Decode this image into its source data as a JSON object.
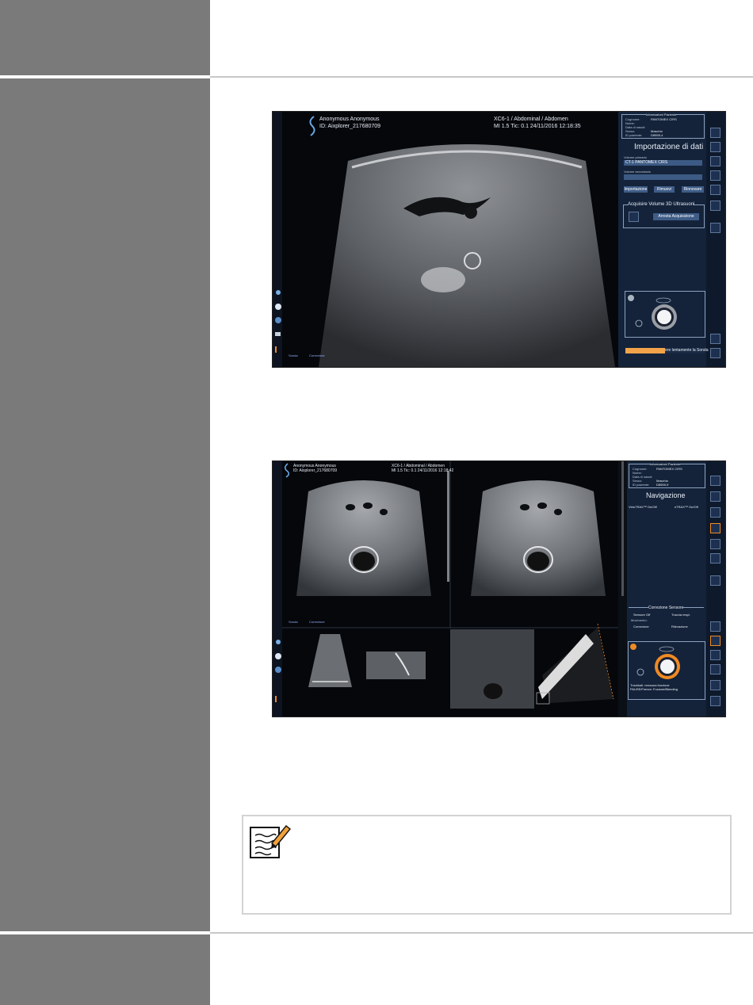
{
  "colors": {
    "sidebar": "#7a7a7a",
    "rule": "#c8c8c8",
    "panel": "#14233a",
    "accent_orange": "#f08a24",
    "field_blue": "#3c5a84"
  },
  "screen1": {
    "patient_name": "Anonymous Anonymous",
    "patient_id": "ID: Aixplorer_217680709",
    "probe_preset": "XC6-1 / Abdominal / Abdomen",
    "mi_tic_date": "MI 1.5  Tic: 0.1   24/11/2016 12:18:35",
    "patient_info": {
      "title": "Informazioni Paziente",
      "rows": [
        {
          "label": "Cognome:",
          "value": "PANTOMEX CIRS"
        },
        {
          "label": "Nome:",
          "value": ""
        },
        {
          "label": "Data di nascit:",
          "value": ""
        },
        {
          "label": "Sesso:",
          "value": "Maschio"
        },
        {
          "label": "ID paziente:",
          "value": "D8555-4"
        }
      ]
    },
    "section_title": "Importazione di dati",
    "primary_label": "Volume primario",
    "primary_value": "CT-1 PANTOMEX CIRS",
    "secondary_label": "Volume secondario",
    "buttons": [
      "Importazione",
      "Rimuovi",
      "Rinnovare"
    ],
    "acquire_title": "Acquisire Volume 3D Ultrasuoni",
    "acquire_button": "Arresta Acquisizione",
    "status_bar": "ere lentamente la Sonda",
    "bottom_labels": [
      "Sonda",
      "Correzione"
    ]
  },
  "screen2": {
    "patient_name": "Anonymous Anonymous",
    "patient_id": "ID: Aixplorer_217680709",
    "probe_preset": "XC6-1 / Abdominal / Abdomen",
    "mi_tic_date": "MI 1.5  Tic: 0.1   24/11/2016 12:18:42",
    "patient_info": {
      "title": "Informazioni Paziente",
      "rows": [
        {
          "label": "Cognome:",
          "value": "PANTOMEX CIRS"
        },
        {
          "label": "Nome:",
          "value": ""
        },
        {
          "label": "Data di nascit:",
          "value": ""
        },
        {
          "label": "Sesso:",
          "value": "Maschio"
        },
        {
          "label": "ID paziente:",
          "value": "D8555-9"
        }
      ]
    },
    "section_title": "Navigazione",
    "nav_left": "VirtuTRAX™ On/Off",
    "nav_right": "eTRAX™ On/Off",
    "sensor_title": "Correzione Sensore",
    "sensor_off": "Sensore Off",
    "resp_trace": "Traccia respi.",
    "movement_label": "Movimento:",
    "correction": "Correzione",
    "detection": "Rilevazione",
    "trackball_hint": "Trackball: nessuna funzione",
    "trackball_hint2": "PAUSE/Freeze: Fusione/Blending",
    "bottom_labels": [
      "Sonda",
      "Correzione"
    ]
  }
}
